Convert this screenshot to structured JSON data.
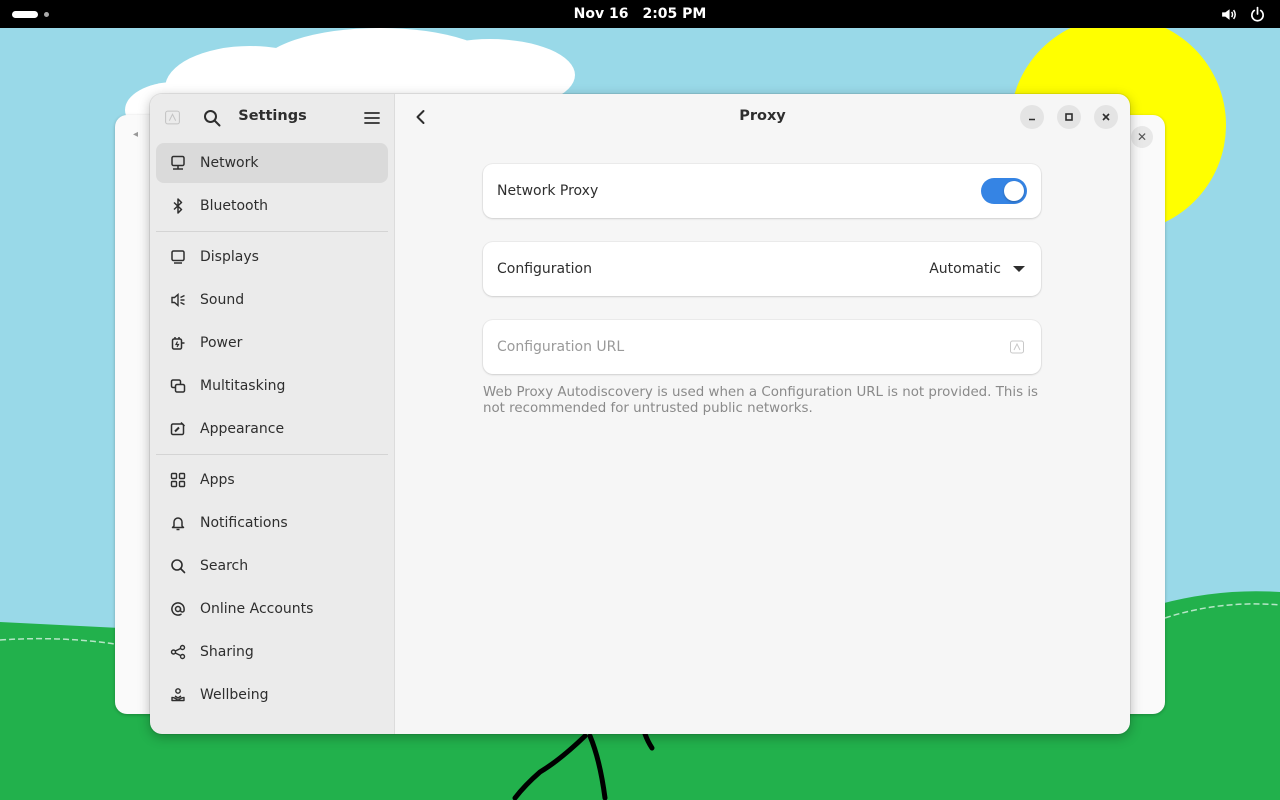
{
  "topbar": {
    "date": "Nov 16",
    "time": "2:05 PM",
    "icons": [
      "volume-icon",
      "power-icon"
    ]
  },
  "sidebar": {
    "title": "Settings",
    "groups": [
      [
        {
          "label": "Network",
          "icon": "network-icon",
          "active": true
        },
        {
          "label": "Bluetooth",
          "icon": "bluetooth-icon"
        }
      ],
      [
        {
          "label": "Displays",
          "icon": "display-icon"
        },
        {
          "label": "Sound",
          "icon": "sound-icon"
        },
        {
          "label": "Power",
          "icon": "power-plug-icon"
        },
        {
          "label": "Multitasking",
          "icon": "multitasking-icon"
        },
        {
          "label": "Appearance",
          "icon": "appearance-icon"
        }
      ],
      [
        {
          "label": "Apps",
          "icon": "apps-grid-icon"
        },
        {
          "label": "Notifications",
          "icon": "bell-icon"
        },
        {
          "label": "Search",
          "icon": "search-icon"
        },
        {
          "label": "Online Accounts",
          "icon": "at-sign-icon"
        },
        {
          "label": "Sharing",
          "icon": "share-icon"
        },
        {
          "label": "Wellbeing",
          "icon": "wellbeing-icon"
        }
      ]
    ]
  },
  "content": {
    "title": "Proxy",
    "network_proxy": {
      "label": "Network Proxy",
      "enabled": true
    },
    "configuration": {
      "label": "Configuration",
      "value": "Automatic"
    },
    "configuration_url": {
      "placeholder": "Configuration URL",
      "value": ""
    },
    "help_text": "Web Proxy Autodiscovery is used when a Configuration URL is not provided. This is not recommended for untrusted public networks."
  },
  "colors": {
    "accent": "#3584e4",
    "sky": "#99d9e8",
    "grass": "#22b14c",
    "sun": "#ffff00"
  }
}
